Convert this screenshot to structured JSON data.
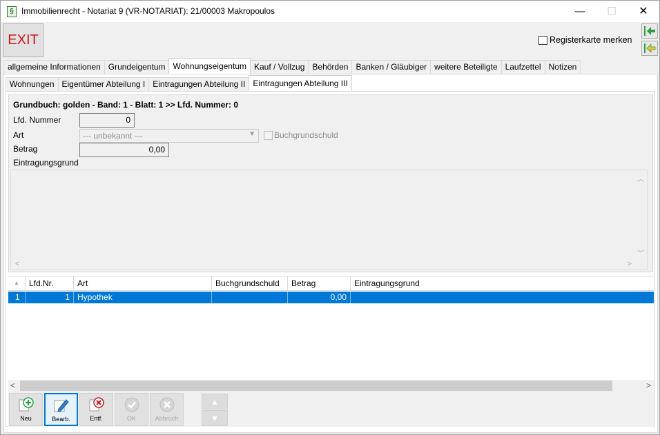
{
  "window": {
    "title": "Immobilienrecht - Notariat 9 (VR-NOTARIAT): 21/00003 Makropoulos",
    "minimize_glyph": "—",
    "maximize_glyph": "☐",
    "close_glyph": "✕"
  },
  "toolbar": {
    "exit_label": "EXIT",
    "register_label": "Registerkarte merken",
    "register_checked": false
  },
  "main_tabs": [
    {
      "label": "allgemeine Informationen"
    },
    {
      "label": "Grundeigentum"
    },
    {
      "label": "Wohnungseigentum",
      "active": true
    },
    {
      "label": "Kauf / Vollzug"
    },
    {
      "label": "Behörden"
    },
    {
      "label": "Banken / Gläubiger"
    },
    {
      "label": "weitere Beteiligte"
    },
    {
      "label": "Laufzettel"
    },
    {
      "label": "Notizen"
    }
  ],
  "sub_tabs": [
    {
      "label": "Wohnungen"
    },
    {
      "label": "Eigentümer Abteilung I"
    },
    {
      "label": "Eintragungen Abteilung II"
    },
    {
      "label": "Eintragungen Abteilung III",
      "active": true
    }
  ],
  "form": {
    "header": "Grundbuch: golden - Band: 1 - Blatt: 1 >> Lfd. Nummer: 0",
    "lfd_label": "Lfd. Nummer",
    "lfd_value": "0",
    "art_label": "Art",
    "art_value": "--- unbekannt ---",
    "buchgrundschuld_label": "Buchgrundschuld",
    "betrag_label": "Betrag",
    "betrag_value": "0,00",
    "grund_label": "Eintragungsgrund"
  },
  "grid": {
    "columns": [
      "Lfd.Nr.",
      "Art",
      "Buchgrundschuld",
      "Betrag",
      "Eintragungsgrund"
    ],
    "rows": [
      {
        "index": "1",
        "lfd": "1",
        "art": "Hypothek",
        "buchgrundschuld": "",
        "betrag": "0,00",
        "grund": ""
      }
    ]
  },
  "actions": {
    "neu": "Neu",
    "bearb": "Bearb.",
    "entf": "Entf.",
    "ok": "OK",
    "abbruch": "Abbruch"
  },
  "colors": {
    "accent": "#0078d7",
    "exit_text": "#d0161b",
    "add_green": "#22a33a",
    "delete_red": "#d11a1a",
    "nav_green": "#2e9e3e",
    "nav_yellow": "#f2c12e"
  }
}
